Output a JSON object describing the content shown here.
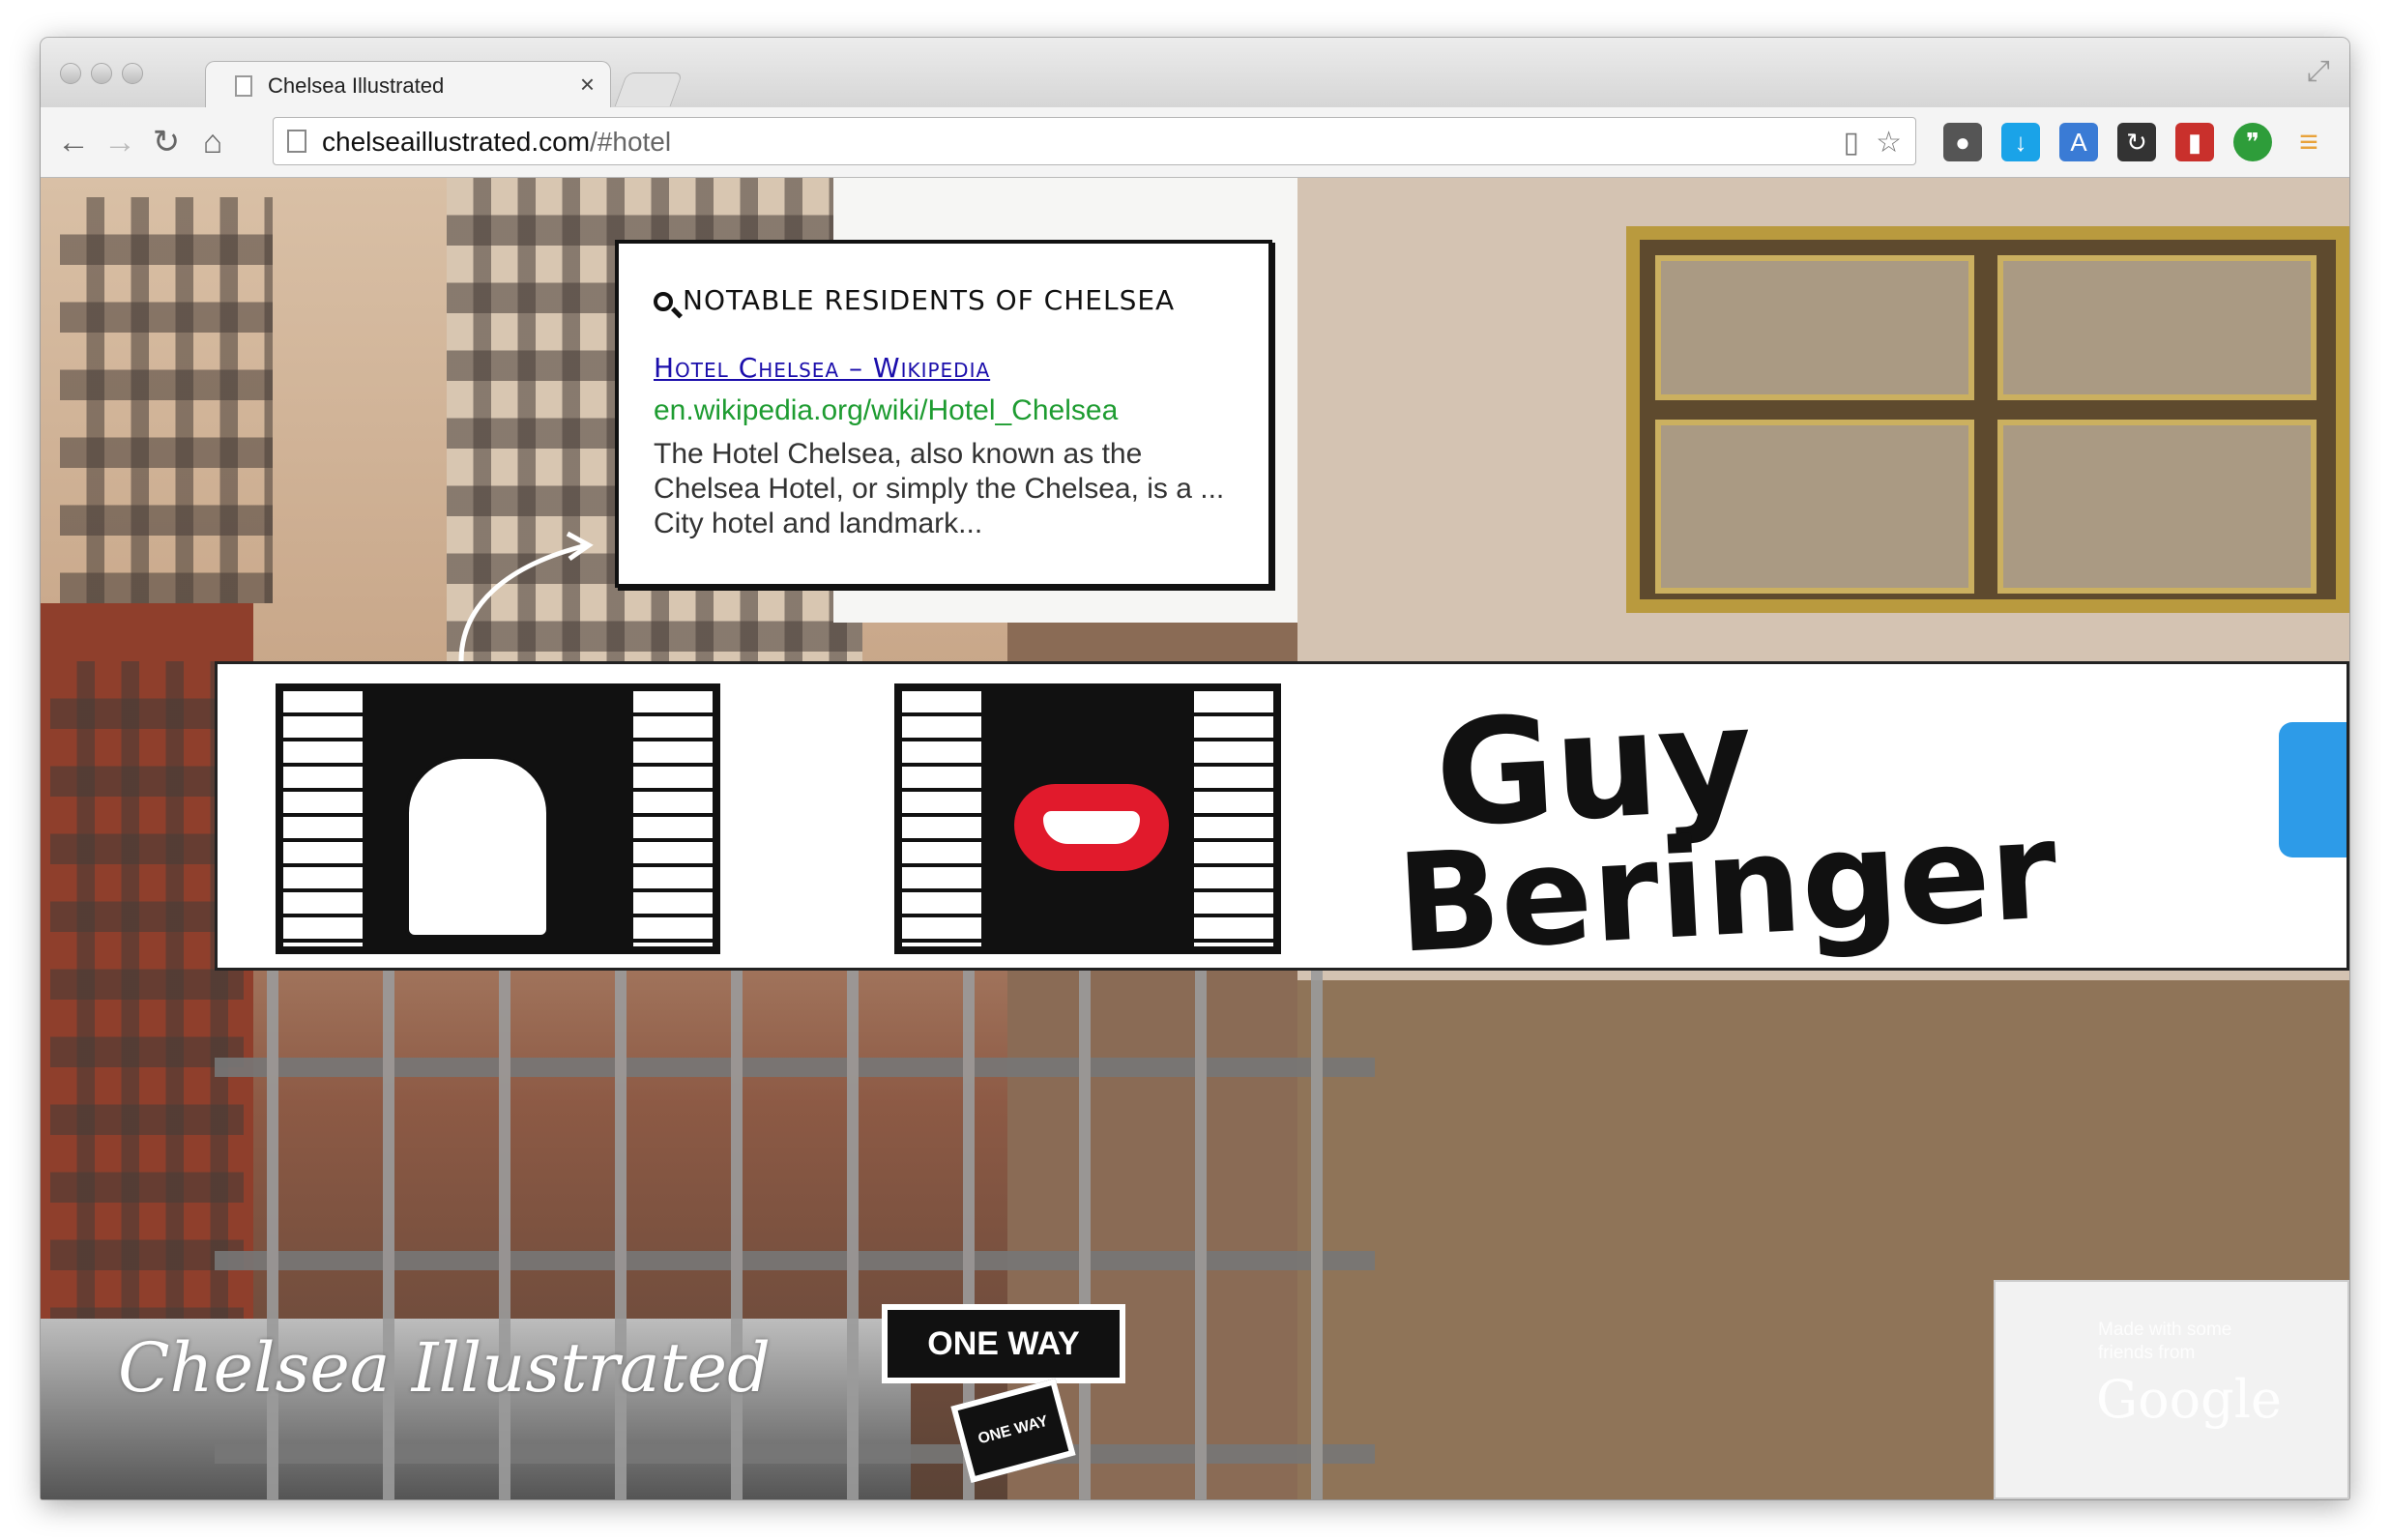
{
  "browser": {
    "tab_title": "Chelsea Illustrated",
    "tab_close_glyph": "×",
    "url_host": "chelseaillustrated.com",
    "url_path": "/#hotel",
    "extensions": [
      {
        "name": "evernote-icon",
        "color": "#4a4a4a"
      },
      {
        "name": "download-icon",
        "color": "#1aa3e8"
      },
      {
        "name": "translate-icon",
        "color": "#3a7bd5"
      },
      {
        "name": "sync-icon",
        "color": "#333333"
      },
      {
        "name": "bookmark-red-icon",
        "color": "#c9302c"
      },
      {
        "name": "hangouts-icon",
        "color": "#2e9d3a"
      },
      {
        "name": "menu-icon",
        "color": "#e8a23a"
      }
    ]
  },
  "callout": {
    "heading": "NOTABLE RESIDENTS OF CHELSEA",
    "result_title": "Hotel Chelsea – Wikipedia",
    "result_url": "en.wikipedia.org/wiki/Hotel_Chelsea",
    "result_snippet": "The Hotel Chelsea, also known as the Chelsea Hotel, or simply the Chelsea, is a ... City hotel and landmark..."
  },
  "billboard": {
    "graffiti_line1": "Guy",
    "graffiti_line2": "Beringer"
  },
  "signs": {
    "one_way_1": "ONE WAY",
    "one_way_2": "ONE WAY"
  },
  "footer": {
    "logo": "Chelsea Illustrated",
    "made_with": "Made with some friends from",
    "google": "Google"
  }
}
